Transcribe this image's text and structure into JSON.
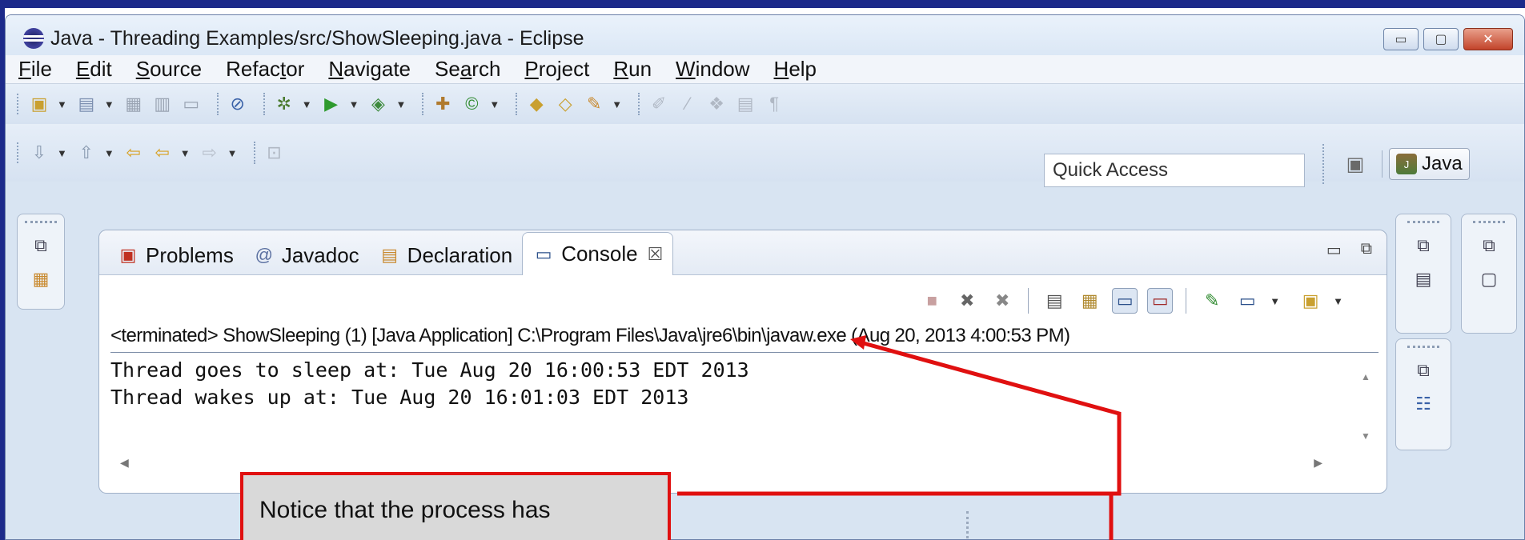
{
  "window": {
    "title": "Java - Threading Examples/src/ShowSleeping.java - Eclipse",
    "controls": {
      "minimize": "▭",
      "maximize": "▢",
      "close": "✕"
    }
  },
  "menubar": {
    "items": [
      {
        "mnemonic": "F",
        "rest": "ile"
      },
      {
        "mnemonic": "E",
        "rest": "dit"
      },
      {
        "mnemonic": "S",
        "rest": "ource"
      },
      {
        "pre": "Refac",
        "mnemonic": "t",
        "rest": "or"
      },
      {
        "mnemonic": "N",
        "rest": "avigate"
      },
      {
        "pre": "Se",
        "mnemonic": "a",
        "rest": "rch"
      },
      {
        "mnemonic": "P",
        "rest": "roject"
      },
      {
        "mnemonic": "R",
        "rest": "un"
      },
      {
        "mnemonic": "W",
        "rest": "indow"
      },
      {
        "mnemonic": "H",
        "rest": "elp"
      }
    ]
  },
  "toolbar": {
    "quick_access_placeholder": "Quick Access",
    "perspective_label": "Java"
  },
  "views": {
    "tabs": [
      {
        "label": "Problems",
        "icon": "problems-icon",
        "active": false
      },
      {
        "label": "Javadoc",
        "icon": "javadoc-icon",
        "active": false
      },
      {
        "label": "Declaration",
        "icon": "declaration-icon",
        "active": false
      },
      {
        "label": "Console",
        "icon": "console-icon",
        "active": true
      }
    ]
  },
  "console": {
    "terminated_label": "<terminated> ShowSleeping (1) [Java Application] C:\\Program Files\\Java\\jre6\\bin\\javaw.exe (Aug 20, 2013 4:00:53 PM)",
    "lines": [
      "Thread goes to sleep at: Tue Aug 20 16:00:53 EDT 2013",
      "Thread wakes up at: Tue Aug 20 16:01:03 EDT 2013"
    ]
  },
  "callout": {
    "text": "Notice that the process has"
  },
  "colors": {
    "slide_frame": "#1c2a8a",
    "annotation": "#e01010"
  }
}
